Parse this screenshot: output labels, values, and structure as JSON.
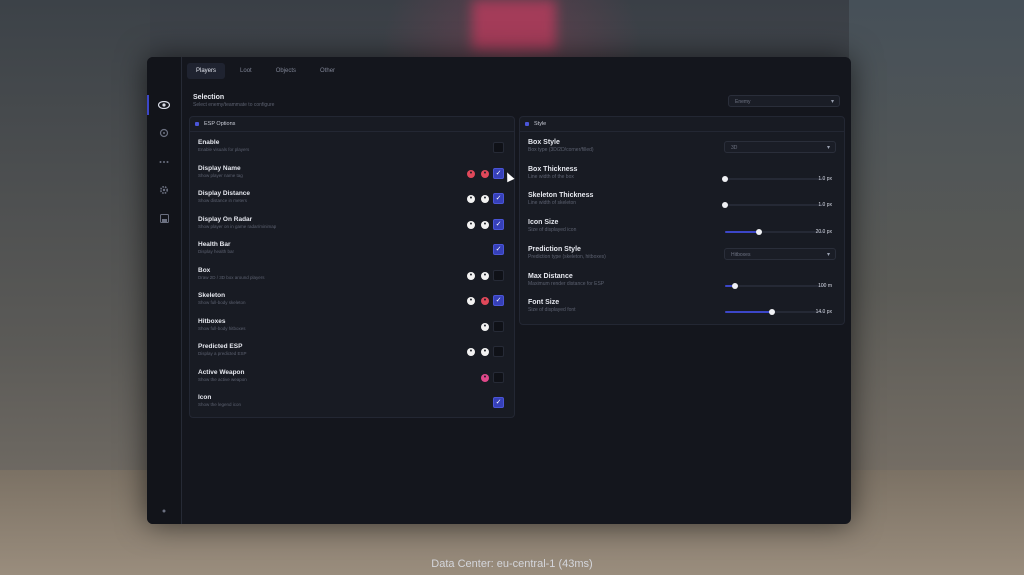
{
  "tabs": [
    "Players",
    "Loot",
    "Objects",
    "Other"
  ],
  "selection": {
    "title": "Selection",
    "subtitle": "Select enemy/teammate to configure",
    "dropdown": "Enemy"
  },
  "esp_panel": {
    "title": "ESP Options",
    "rows": [
      {
        "title": "Enable",
        "subtitle": "Enable visuals for players",
        "checked": false
      },
      {
        "title": "Display Name",
        "subtitle": "Show player name tag",
        "checked": true
      },
      {
        "title": "Display Distance",
        "subtitle": "Show distance in meters",
        "checked": true
      },
      {
        "title": "Display On Radar",
        "subtitle": "Show player on in game radar/minimap",
        "checked": true
      },
      {
        "title": "Health Bar",
        "subtitle": "Display health bar",
        "checked": true
      },
      {
        "title": "Box",
        "subtitle": "Draw 2D / 3D box around players",
        "checked": false
      },
      {
        "title": "Skeleton",
        "subtitle": "Show full-body skeleton",
        "checked": true
      },
      {
        "title": "Hitboxes",
        "subtitle": "Show full-body hitboxes",
        "checked": false
      },
      {
        "title": "Predicted ESP",
        "subtitle": "Display a predicted ESP",
        "checked": false
      },
      {
        "title": "Active Weapon",
        "subtitle": "Show the active weapon",
        "checked": false
      },
      {
        "title": "Icon",
        "subtitle": "Show the legend icon",
        "checked": true
      }
    ]
  },
  "style_panel": {
    "title": "Style",
    "box_style": {
      "title": "Box Style",
      "subtitle": "Box type (3D/2D/corner/filled)",
      "value": "3D"
    },
    "box_thickness": {
      "title": "Box Thickness",
      "subtitle": "Line width of the box",
      "value": "1.0 px",
      "level": 0.0
    },
    "skeleton_thickness": {
      "title": "Skeleton Thickness",
      "subtitle": "Line width of skeleton",
      "value": "1.0 px",
      "level": 0.0
    },
    "icon_size": {
      "title": "Icon Size",
      "subtitle": "Size of displayed icon",
      "value": "20.0 px",
      "level": 0.34
    },
    "prediction_style": {
      "title": "Prediction Style",
      "subtitle": "Prediction type (skeleton, hitboxes)",
      "value": "Hitboxes"
    },
    "max_distance": {
      "title": "Max Distance",
      "subtitle": "Maximum render distance for ESP",
      "value": "100 m",
      "level": 0.1
    },
    "font_size": {
      "title": "Font Size",
      "subtitle": "Size of displayed font",
      "value": "14.0 px",
      "level": 0.47
    }
  },
  "colors": {
    "accent": "#3c46c8",
    "palette_red": "#e0485a",
    "palette_pink": "#e0488a",
    "palette_white": "#f2f2f2"
  },
  "footer": "Data Center: eu-central-1 (43ms)"
}
